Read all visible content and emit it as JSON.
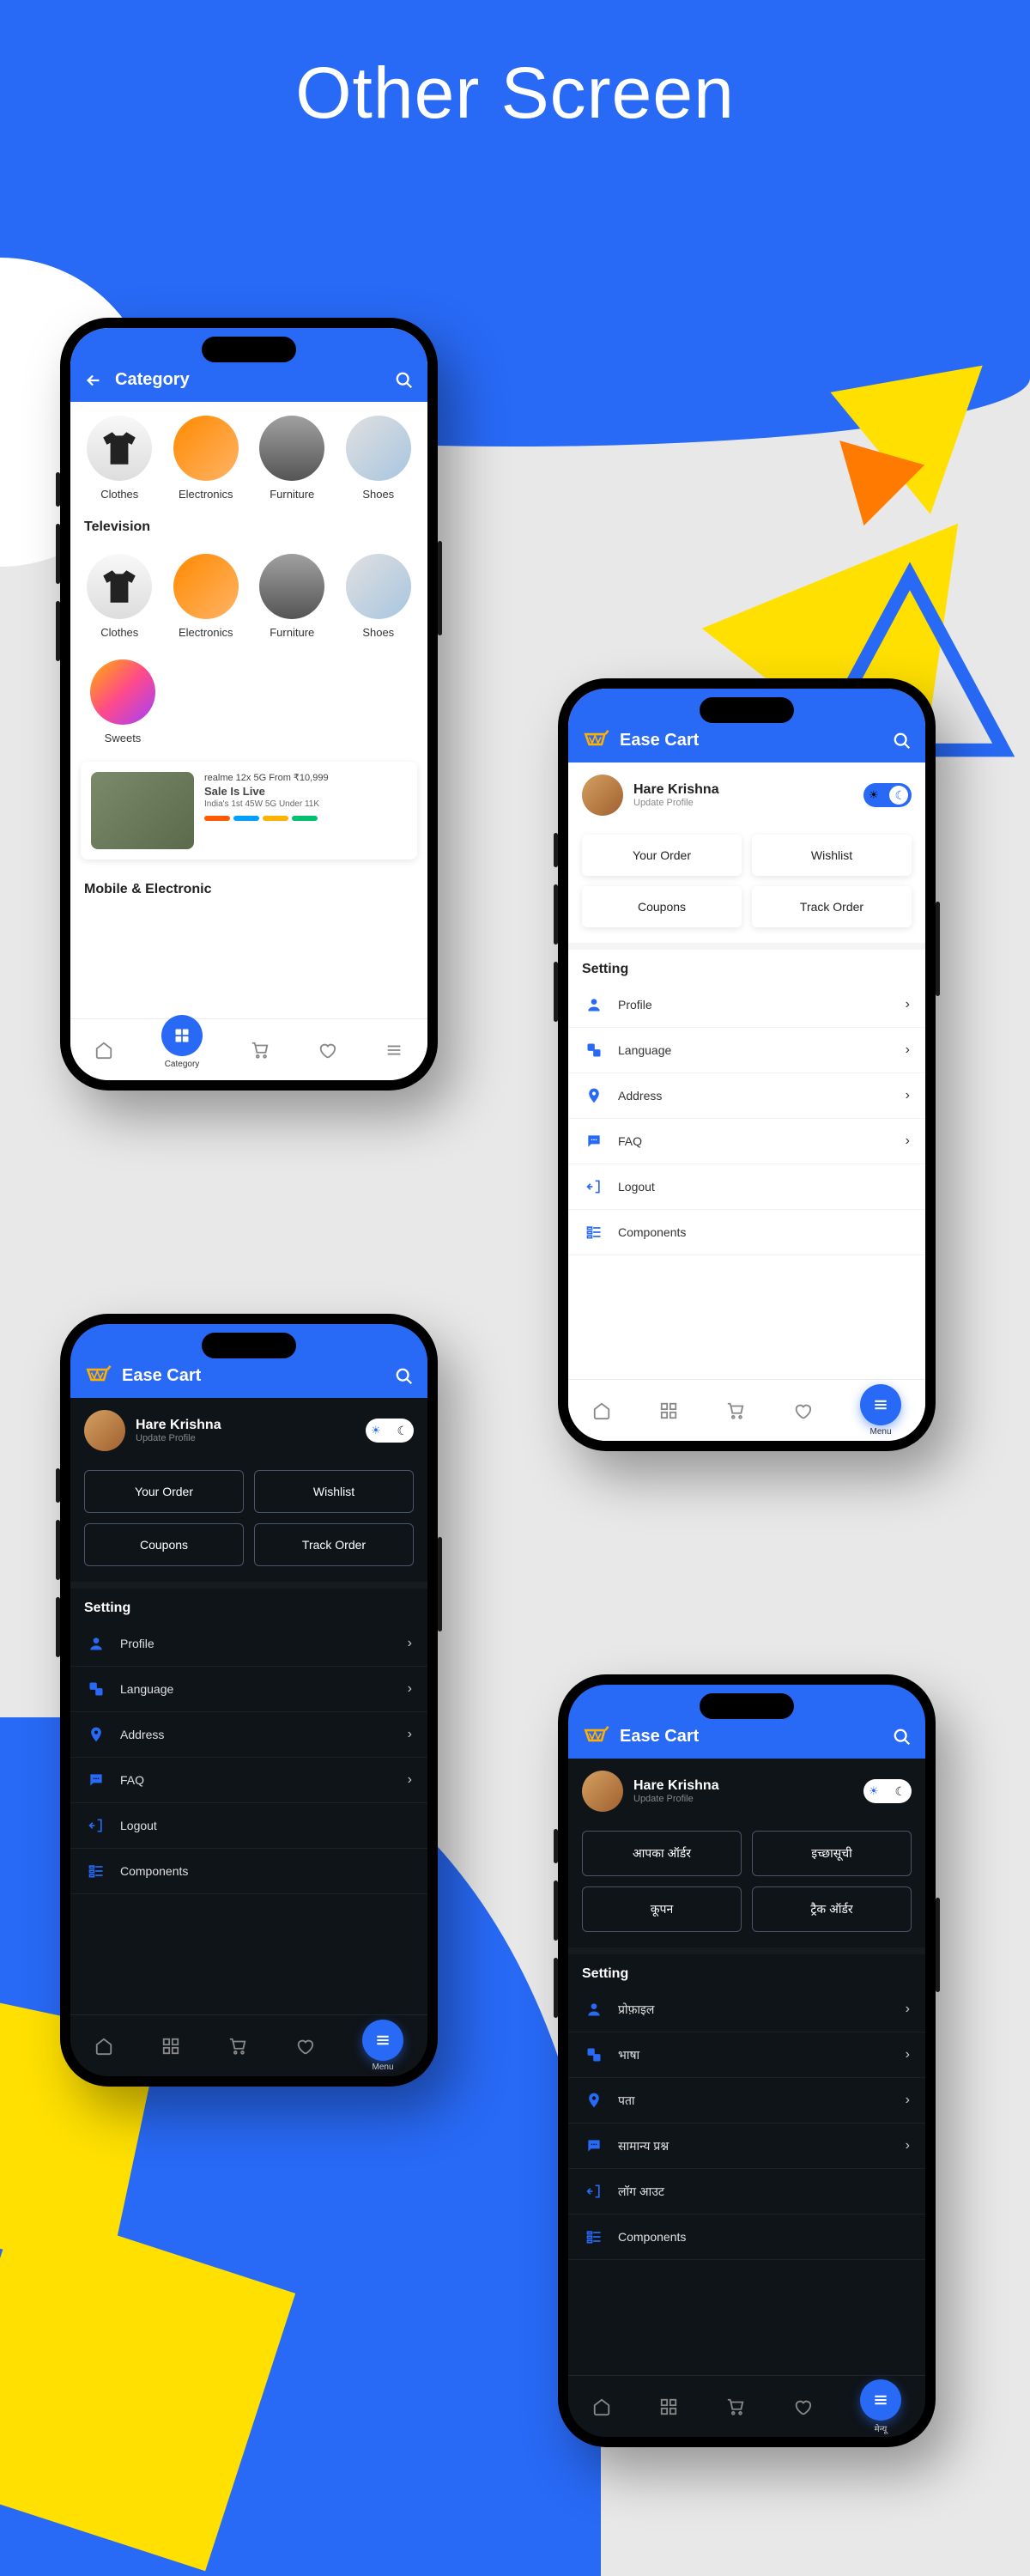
{
  "page_title": "Other Screen",
  "phone1": {
    "header": {
      "title": "Category"
    },
    "categories_row1": [
      {
        "label": "Clothes"
      },
      {
        "label": "Electronics"
      },
      {
        "label": "Furniture"
      },
      {
        "label": "Shoes"
      }
    ],
    "section2": "Television",
    "categories_row2": [
      {
        "label": "Clothes"
      },
      {
        "label": "Electronics"
      },
      {
        "label": "Furniture"
      },
      {
        "label": "Shoes"
      }
    ],
    "categories_row3": [
      {
        "label": "Sweets"
      }
    ],
    "banner": {
      "line1": "realme 12x 5G  From ₹10,999",
      "line2": "Sale Is Live",
      "line3": "India's 1st 45W 5G Under 11K"
    },
    "section3": "Mobile & Electronic",
    "nav": {
      "active_label": "Category"
    }
  },
  "phone2": {
    "header": {
      "app_name": "Ease Cart"
    },
    "profile": {
      "name": "Hare Krishna",
      "sub": "Update Profile"
    },
    "actions": [
      "Your Order",
      "Wishlist",
      "Coupons",
      "Track Order"
    ],
    "setting_title": "Setting",
    "settings": [
      "Profile",
      "Language",
      "Address",
      "FAQ",
      "Logout",
      "Components"
    ],
    "nav": {
      "fab_label": "Menu"
    }
  },
  "phone3": {
    "header": {
      "app_name": "Ease Cart"
    },
    "profile": {
      "name": "Hare Krishna",
      "sub": "Update Profile"
    },
    "actions": [
      "Your Order",
      "Wishlist",
      "Coupons",
      "Track Order"
    ],
    "setting_title": "Setting",
    "settings": [
      "Profile",
      "Language",
      "Address",
      "FAQ",
      "Logout",
      "Components"
    ],
    "nav": {
      "fab_label": "Menu"
    }
  },
  "phone4": {
    "header": {
      "app_name": "Ease Cart"
    },
    "profile": {
      "name": "Hare Krishna",
      "sub": "Update Profile"
    },
    "actions": [
      "आपका ऑर्डर",
      "इच्छासूची",
      "कूपन",
      "ट्रैक ऑर्डर"
    ],
    "setting_title": "Setting",
    "settings": [
      "प्रोफ़ाइल",
      "भाषा",
      "पता",
      "सामान्य प्रश्न",
      "लॉग आउट",
      "Components"
    ],
    "nav": {
      "fab_label": "मेन्यू"
    }
  }
}
